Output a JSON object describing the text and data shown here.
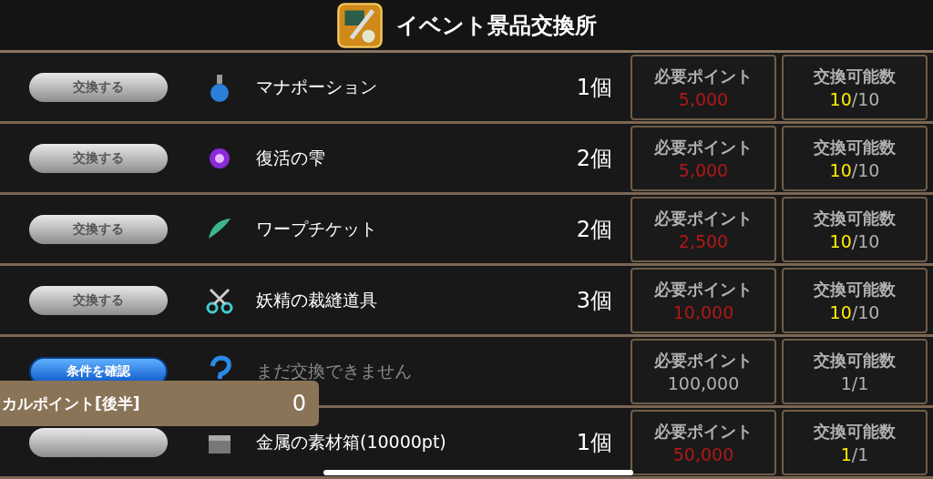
{
  "header": {
    "title": "イベント景品交換所"
  },
  "rows": [
    {
      "kind": "exchange",
      "button": "交換する",
      "name": "マナポーション",
      "count": "1個",
      "points_label": "必要ポイント",
      "points": "5,000",
      "limit_label": "交換可能数",
      "limit_current": "10",
      "limit_rest": "/10"
    },
    {
      "kind": "exchange",
      "button": "交換する",
      "name": "復活の雫",
      "count": "2個",
      "points_label": "必要ポイント",
      "points": "5,000",
      "limit_label": "交換可能数",
      "limit_current": "10",
      "limit_rest": "/10"
    },
    {
      "kind": "exchange",
      "button": "交換する",
      "name": "ワープチケット",
      "count": "2個",
      "points_label": "必要ポイント",
      "points": "2,500",
      "limit_label": "交換可能数",
      "limit_current": "10",
      "limit_rest": "/10"
    },
    {
      "kind": "exchange",
      "button": "交換する",
      "name": "妖精の裁縫道具",
      "count": "3個",
      "points_label": "必要ポイント",
      "points": "10,000",
      "limit_label": "交換可能数",
      "limit_current": "10",
      "limit_rest": "/10"
    },
    {
      "kind": "locked",
      "button": "条件を確認",
      "name": "まだ交換できません",
      "points_label": "必要ポイント",
      "points": "100,000",
      "limit_label": "交換可能数",
      "limit_current": "1",
      "limit_rest": "/1"
    },
    {
      "kind": "exchange",
      "name": "金属の素材箱(10000pt)",
      "count": "1個",
      "points_label": "必要ポイント",
      "points": "50,000",
      "limit_label": "交換可能数",
      "limit_current": "1",
      "limit_rest": "/1"
    }
  ],
  "point_panel": {
    "label": "カルポイント[後半]",
    "value": "0"
  }
}
